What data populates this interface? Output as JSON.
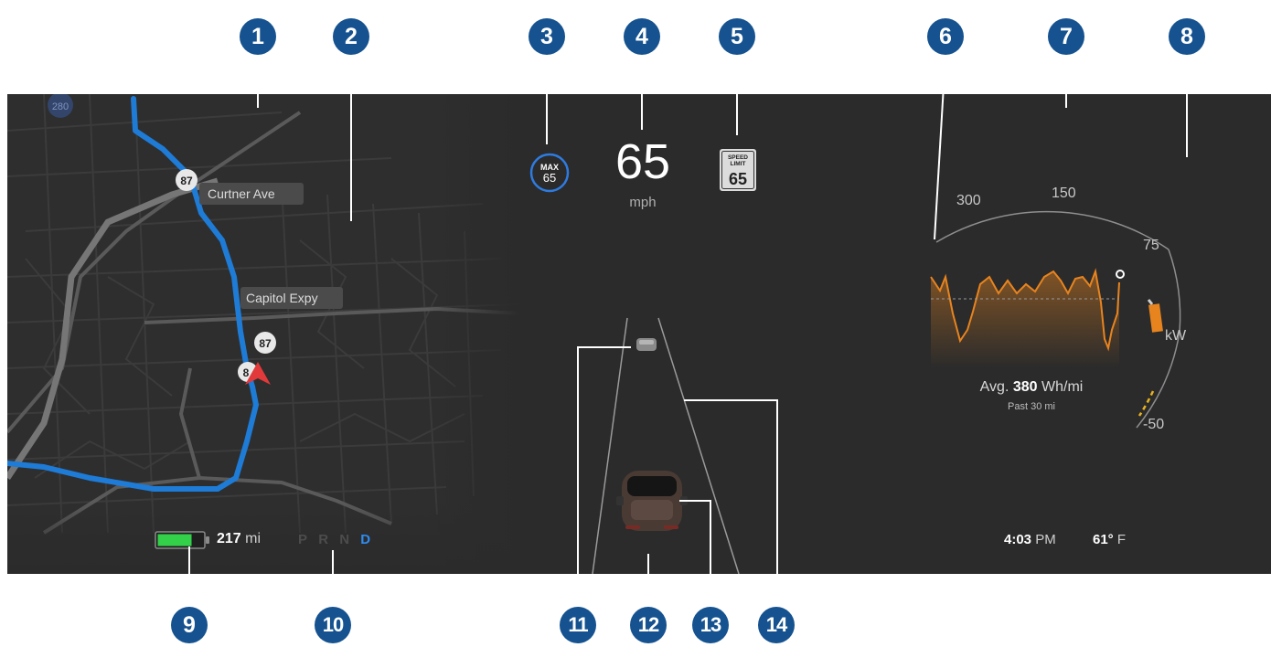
{
  "callouts": [
    "1",
    "2",
    "3",
    "4",
    "5",
    "6",
    "7",
    "8",
    "9",
    "10",
    "11",
    "12",
    "13",
    "14"
  ],
  "map": {
    "route_shield_top": "87",
    "route_shield_mid": "87",
    "route_shield_low": "8",
    "interstate_shield": "280",
    "street_1": "Curtner Ave",
    "street_2": "Capitol Expy"
  },
  "speed": {
    "max_label": "MAX",
    "max_value": "65",
    "current": "65",
    "unit": "mph",
    "limit_line1": "SPEED",
    "limit_line2": "LIMIT",
    "limit_value": "65"
  },
  "power": {
    "scale_300": "300",
    "scale_150": "150",
    "scale_75": "75",
    "scale_neg50": "-50",
    "unit": "kW",
    "avg_prefix": "Avg.",
    "avg_value": "380",
    "avg_unit": "Wh/mi",
    "window": "Past 30 mi"
  },
  "status": {
    "range": "217",
    "range_unit": "mi",
    "gears": [
      "P",
      "R",
      "N",
      "D"
    ],
    "selected_gear": "D",
    "time": "4:03",
    "ampm": "PM",
    "temp": "61°",
    "temp_unit": "F"
  },
  "colors": {
    "dash_bg": "#2b2b2b",
    "route_blue": "#1e7bd6",
    "callout_blue": "#15528f",
    "energy_orange": "#e8841e",
    "battery_green": "#33d14a"
  }
}
